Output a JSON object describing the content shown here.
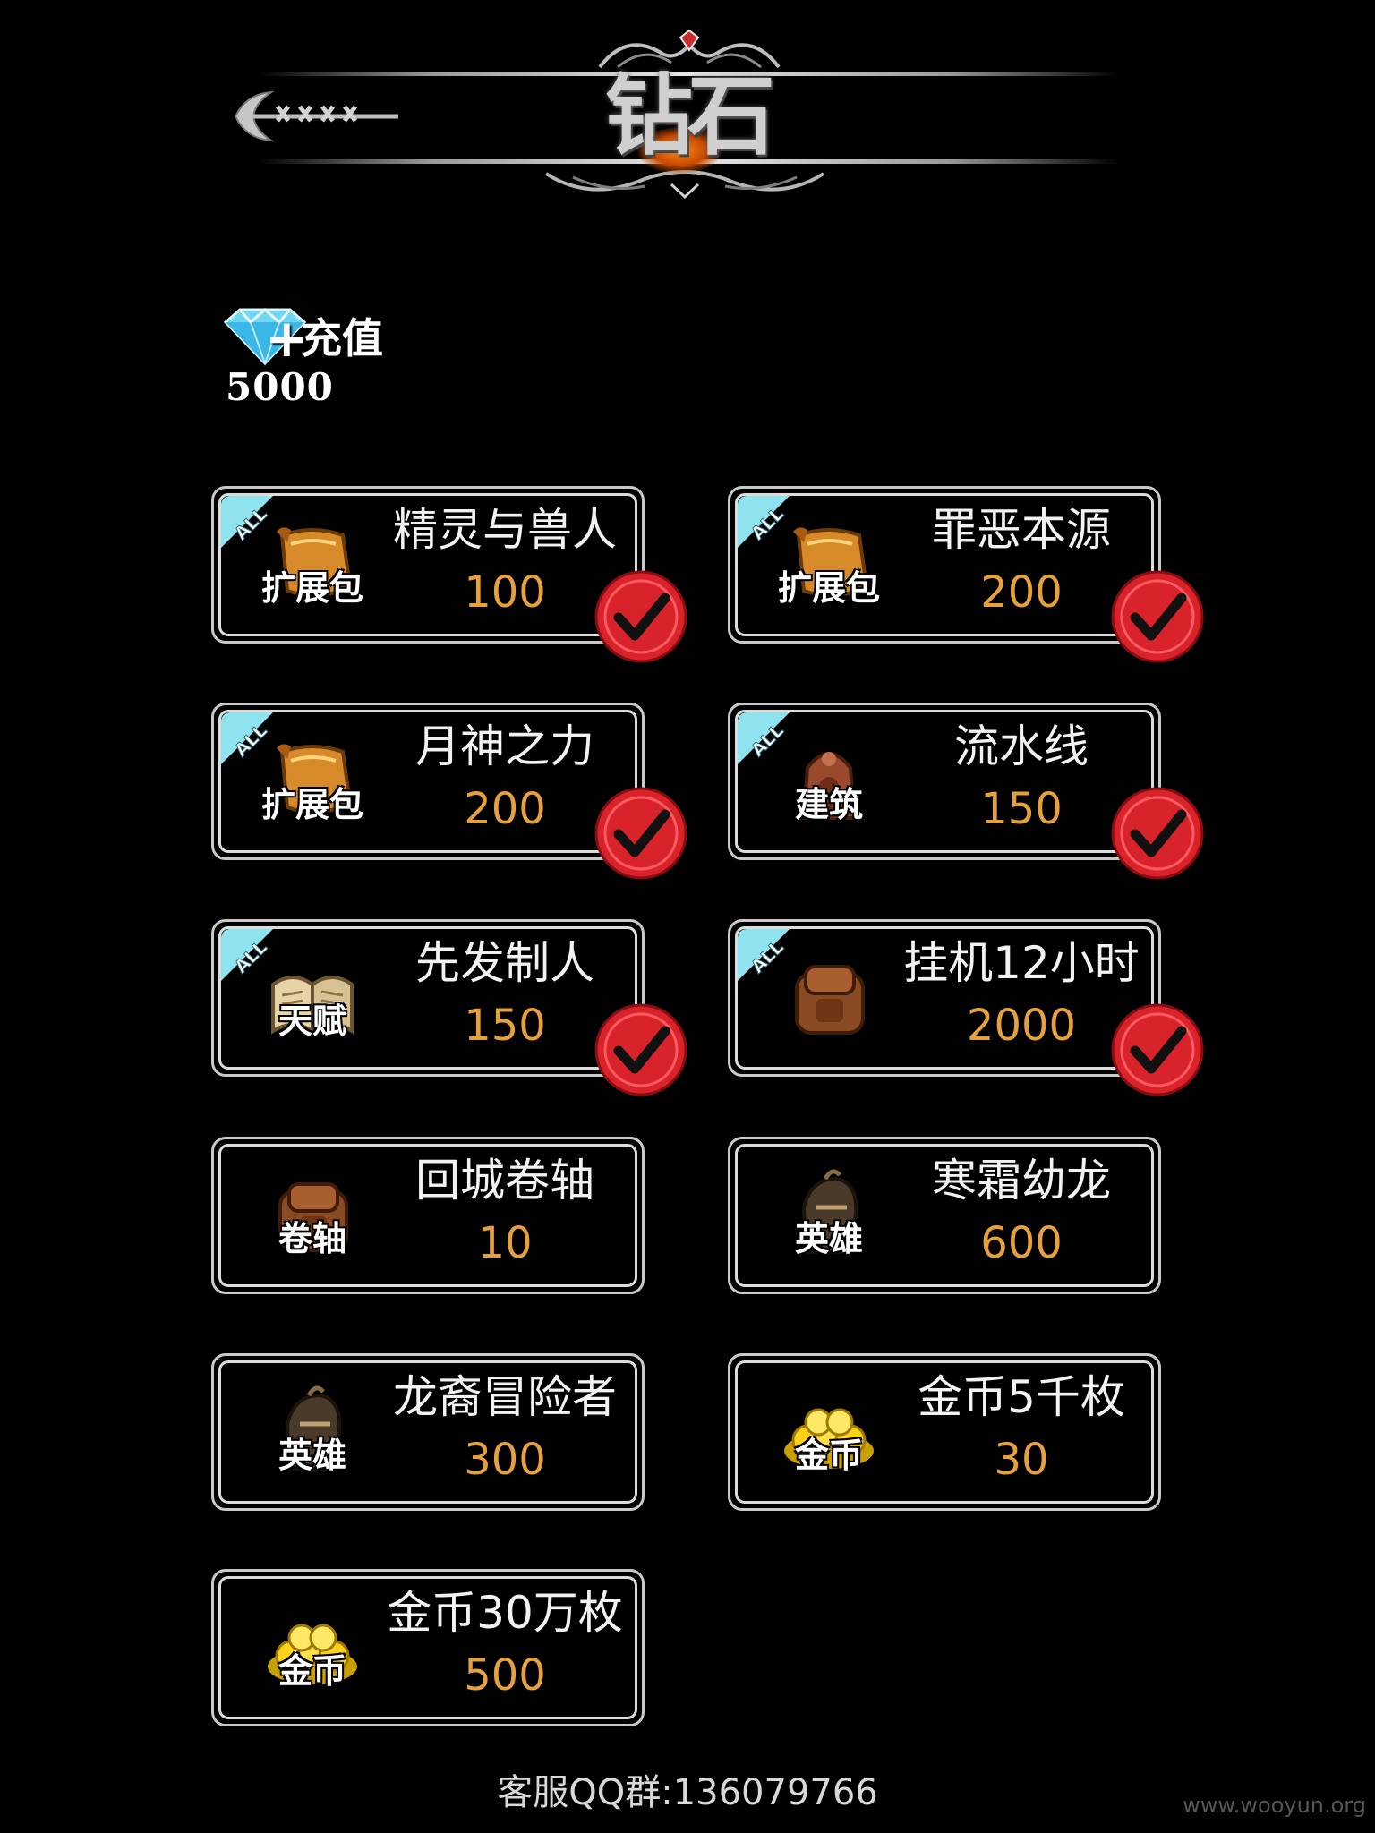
{
  "header": {
    "title": "钻石"
  },
  "wallet": {
    "recharge_label": "充值",
    "balance": "5000"
  },
  "items": [
    {
      "name": "精灵与兽人",
      "price": "100",
      "category": "扩展包",
      "icon": "scroll-icon",
      "all_tag": "ALL",
      "owned": true
    },
    {
      "name": "罪恶本源",
      "price": "200",
      "category": "扩展包",
      "icon": "scroll-icon",
      "all_tag": "ALL",
      "owned": true
    },
    {
      "name": "月神之力",
      "price": "200",
      "category": "扩展包",
      "icon": "scroll-icon",
      "all_tag": "ALL",
      "owned": true
    },
    {
      "name": "流水线",
      "price": "150",
      "category": "建筑",
      "icon": "building-icon",
      "all_tag": "ALL",
      "owned": true
    },
    {
      "name": "先发制人",
      "price": "150",
      "category": "天赋",
      "icon": "book-icon",
      "all_tag": "ALL",
      "owned": true
    },
    {
      "name": "挂机12小时",
      "price": "2000",
      "category": "",
      "icon": "backpack-icon",
      "all_tag": "ALL",
      "owned": true
    },
    {
      "name": "回城卷轴",
      "price": "10",
      "category": "卷轴",
      "icon": "backpack-icon",
      "all_tag": "",
      "owned": false
    },
    {
      "name": "寒霜幼龙",
      "price": "600",
      "category": "英雄",
      "icon": "knight-helmet-icon",
      "all_tag": "",
      "owned": false
    },
    {
      "name": "龙裔冒险者",
      "price": "300",
      "category": "英雄",
      "icon": "knight-helmet-icon",
      "all_tag": "",
      "owned": false
    },
    {
      "name": "金币5千枚",
      "price": "30",
      "category": "金币",
      "icon": "gold-coins-icon",
      "all_tag": "",
      "owned": false
    },
    {
      "name": "金币30万枚",
      "price": "500",
      "category": "金币",
      "icon": "gold-coins-icon",
      "all_tag": "",
      "owned": false
    }
  ],
  "footer": {
    "support_text": "客服QQ群:136079766"
  },
  "watermark": "www.wooyun.org",
  "colors": {
    "price": "#e6a13c",
    "seal_red": "#d8232a",
    "all_tag": "#8fe3ee",
    "background": "#000000"
  }
}
